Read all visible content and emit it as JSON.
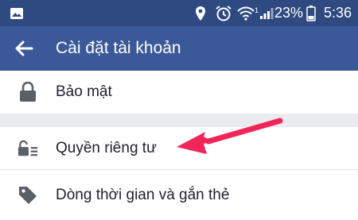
{
  "status_bar": {
    "battery_percent": "23%",
    "time": "5:36",
    "signal_type": "1",
    "icons": [
      "image-icon",
      "location-icon",
      "alarm-icon",
      "wifi-icon",
      "signal-icon",
      "battery-icon"
    ]
  },
  "app_bar": {
    "title": "Cài đặt tài khoản",
    "back_icon": "arrow-left-icon"
  },
  "settings": {
    "items": [
      {
        "label": "Bảo mật",
        "icon": "lock-icon"
      },
      {
        "label": "Quyền riêng tư",
        "icon": "privacy-lock-icon"
      },
      {
        "label": "Dòng thời gian và gắn thẻ",
        "icon": "tag-icon"
      }
    ]
  },
  "colors": {
    "status_bar": "#2e4a80",
    "app_bar": "#3b5998",
    "separator": "#e9ebee",
    "icon": "#5b5f66",
    "annotation_arrow": "#f2255a"
  }
}
